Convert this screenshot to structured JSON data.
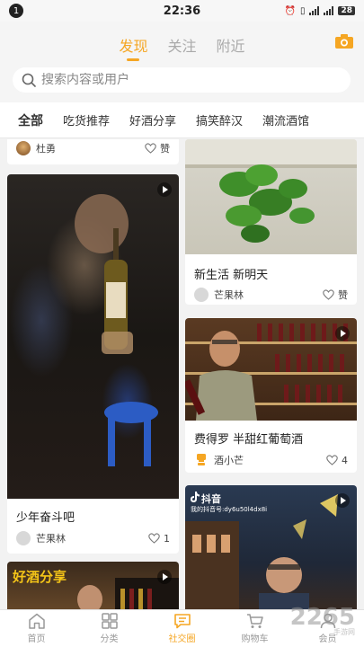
{
  "status_bar": {
    "notification_count": "1",
    "time": "22:36",
    "battery": "28"
  },
  "header": {
    "tabs": [
      {
        "label": "发现",
        "active": true
      },
      {
        "label": "关注",
        "active": false
      },
      {
        "label": "附近",
        "active": false
      }
    ],
    "camera_icon": "camera-icon",
    "accent_color": "#f5a623"
  },
  "search": {
    "placeholder": "搜索内容或用户",
    "icon": "search-icon"
  },
  "categories": [
    {
      "label": "全部",
      "active": true
    },
    {
      "label": "吃货推荐",
      "active": false
    },
    {
      "label": "好酒分享",
      "active": false
    },
    {
      "label": "搞笑醉汉",
      "active": false
    },
    {
      "label": "潮流酒馆",
      "active": false
    }
  ],
  "feed": {
    "left": [
      {
        "title": "",
        "author": "杜勇",
        "like_label": "赞",
        "has_video": false
      },
      {
        "title": "少年奋斗吧",
        "author": "芒果林",
        "like_label": "1",
        "has_video": true
      },
      {
        "title": "",
        "author": "",
        "like_label": "",
        "has_video": true,
        "overlay_text": "好酒分享"
      }
    ],
    "right": [
      {
        "title": "新生活  新明天",
        "author": "芒果林",
        "like_label": "赞",
        "has_video": false
      },
      {
        "title": "费得罗 半甜红葡萄酒",
        "author": "酒小芒",
        "like_label": "4",
        "has_video": true
      },
      {
        "title": "",
        "author": "",
        "like_label": "",
        "has_video": true,
        "overlay_text": "抖音",
        "overlay_sub": "我的抖音号:dy6u50l4dx8i"
      }
    ]
  },
  "bottom_nav": [
    {
      "label": "首页",
      "icon": "home-icon",
      "active": false
    },
    {
      "label": "分类",
      "icon": "grid-icon",
      "active": false
    },
    {
      "label": "社交圈",
      "icon": "chat-icon",
      "active": true
    },
    {
      "label": "购物车",
      "icon": "cart-icon",
      "active": false
    },
    {
      "label": "会员",
      "icon": "person-icon",
      "active": false
    }
  ],
  "watermark": {
    "text": "2265",
    "sub": "手游网"
  }
}
